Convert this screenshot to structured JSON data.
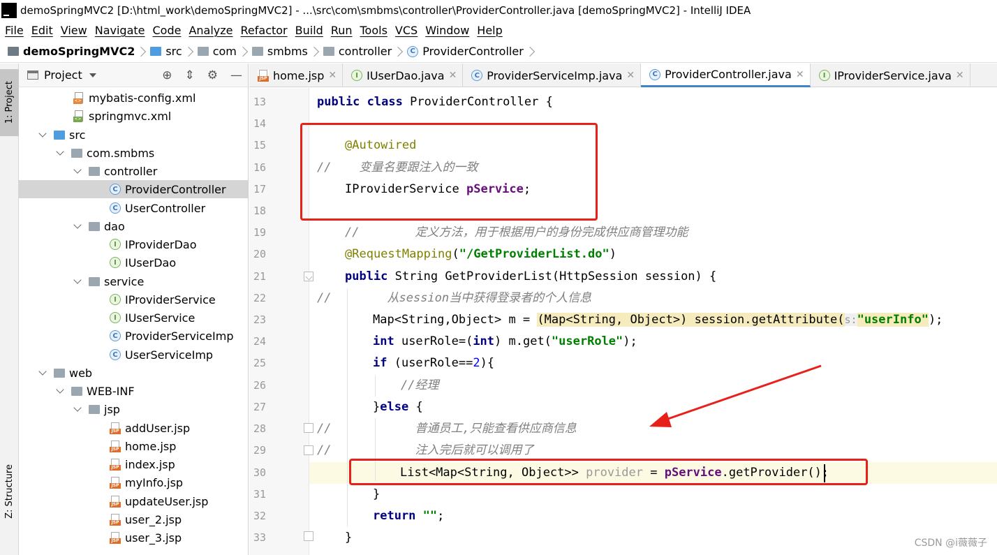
{
  "window": {
    "title": "demoSpringMVC2 [D:\\html_work\\demoSpringMVC2] - ...\\src\\com\\smbms\\controller\\ProviderController.java [demoSpringMVC2] - IntelliJ IDEA"
  },
  "menu": [
    "File",
    "Edit",
    "View",
    "Navigate",
    "Code",
    "Analyze",
    "Refactor",
    "Build",
    "Run",
    "Tools",
    "VCS",
    "Window",
    "Help"
  ],
  "breadcrumb": [
    "demoSpringMVC2",
    "src",
    "com",
    "smbms",
    "controller",
    "ProviderController"
  ],
  "left_stripe": {
    "project": "1: Project",
    "structure": "Z: Structure"
  },
  "project_panel": {
    "title": "Project",
    "tree": [
      {
        "label": "mybatis-config.xml",
        "icon": "xml-icon"
      },
      {
        "label": "springmvc.xml",
        "icon": "spring-xml-icon"
      },
      {
        "label": "src",
        "icon": "folder-icon"
      },
      {
        "label": "com.smbms",
        "icon": "package-icon"
      },
      {
        "label": "controller",
        "icon": "package-icon"
      },
      {
        "label": "ProviderController",
        "icon": "class-icon"
      },
      {
        "label": "UserController",
        "icon": "class-icon"
      },
      {
        "label": "dao",
        "icon": "package-icon"
      },
      {
        "label": "IProviderDao",
        "icon": "interface-icon"
      },
      {
        "label": "IUserDao",
        "icon": "interface-icon"
      },
      {
        "label": "service",
        "icon": "package-icon"
      },
      {
        "label": "IProviderService",
        "icon": "interface-icon"
      },
      {
        "label": "IUserService",
        "icon": "interface-icon"
      },
      {
        "label": "ProviderServiceImp",
        "icon": "class-icon"
      },
      {
        "label": "UserServiceImp",
        "icon": "class-icon"
      },
      {
        "label": "web",
        "icon": "folder-icon"
      },
      {
        "label": "WEB-INF",
        "icon": "folder-icon"
      },
      {
        "label": "jsp",
        "icon": "folder-icon"
      },
      {
        "label": "addUser.jsp",
        "icon": "jsp-icon"
      },
      {
        "label": "home.jsp",
        "icon": "jsp-icon"
      },
      {
        "label": "index.jsp",
        "icon": "jsp-icon"
      },
      {
        "label": "myInfo.jsp",
        "icon": "jsp-icon"
      },
      {
        "label": "updateUser.jsp",
        "icon": "jsp-icon"
      },
      {
        "label": "user_2.jsp",
        "icon": "jsp-icon"
      },
      {
        "label": "user_3.jsp",
        "icon": "jsp-icon"
      }
    ]
  },
  "tabs": [
    {
      "label": "home.jsp",
      "icon": "jsp-icon"
    },
    {
      "label": "IUserDao.java",
      "icon": "interface-icon"
    },
    {
      "label": "ProviderServiceImp.java",
      "icon": "class-icon"
    },
    {
      "label": "ProviderController.java",
      "icon": "class-icon",
      "active": true
    },
    {
      "label": "IProviderService.java",
      "icon": "interface-icon"
    }
  ],
  "editor": {
    "line_numbers": [
      "13",
      "14",
      "15",
      "16",
      "17",
      "18",
      "19",
      "20",
      "21",
      "22",
      "23",
      "24",
      "25",
      "26",
      "27",
      "28",
      "29",
      "30",
      "31",
      "32",
      "33"
    ],
    "lines": {
      "l13_kw1": "public",
      "l13_kw2": "class",
      "l13_rest": "ProviderController {",
      "l15": "@Autowired",
      "l16_slash": "//",
      "l16_cmt": "变量名要跟注入的一致",
      "l17_type": "IProviderService ",
      "l17_field": "pService",
      "l17_end": ";",
      "l19_slash": "//",
      "l19_cmt": "定义方法，用于根据用户的身份完成供应商管理功能",
      "l20_ann": "@RequestMapping",
      "l20_p1": "(",
      "l20_str": "\"/GetProviderList.do\"",
      "l20_p2": ")",
      "l21_kw": "public",
      "l21_rest": "String GetProviderList(HttpSession session) {",
      "l22_slash": "//",
      "l22_cmt": "从session当中获得登录者的个人信息",
      "l23_a": "Map<String,Object> m = ",
      "l23_cast": "(Map<String, Object>)",
      "l23_b": " session.getAttribute(",
      "l23_hint": "s:",
      "l23_str": "\"userInfo\"",
      "l23_c": ");",
      "l24_kw1": "int",
      "l24_a": " userRole=(",
      "l24_kw2": "int",
      "l24_b": ") m.get(",
      "l24_str": "\"userRole\"",
      "l24_c": ");",
      "l25_kw": "if",
      "l25_a": " (userRole==",
      "l25_num": "2",
      "l25_b": "){",
      "l26_cmt": "//经理",
      "l27_a": "}",
      "l27_kw": "else",
      "l27_b": " {",
      "l28_slash": "//",
      "l28_cmt": "普通员工,只能查看供应商信息",
      "l29_slash": "//",
      "l29_cmt": "注入完后就可以调用了",
      "l30_a": "List<Map<String, Object>> ",
      "l30_var": "provider",
      "l30_b": " = ",
      "l30_field": "pService",
      "l30_c": ".getProvider();",
      "l31": "}",
      "l32_kw": "return",
      "l32_str": "\"\"",
      "l32_end": ";",
      "l33": "}"
    }
  },
  "watermark": "CSDN @i薇薇子",
  "colors": {
    "keyword": "#000080",
    "annotation": "#808000",
    "string": "#008000",
    "comment": "#808080",
    "field": "#660e7a",
    "highlight_box": "#e8201a",
    "active_tab_underline": "#4083c9"
  }
}
